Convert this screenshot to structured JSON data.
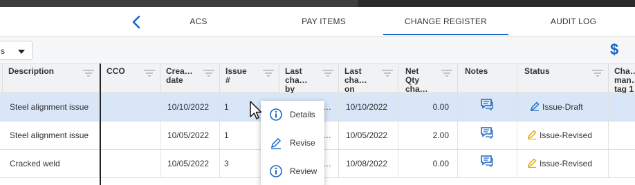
{
  "tabs": {
    "back_icon": "chevron-left-icon",
    "items": [
      {
        "label": "ACS"
      },
      {
        "label": "PAY ITEMS"
      },
      {
        "label": "CHANGE REGISTER"
      },
      {
        "label": "AUDIT LOG"
      }
    ],
    "active": "CHANGE REGISTER",
    "accent": "#1a66c2"
  },
  "toolbar": {
    "select_value": "s",
    "currency_symbol": "$"
  },
  "grid": {
    "columns": [
      {
        "label": "Description"
      },
      {
        "label": "CCO"
      },
      {
        "label": "Crea…\ndate"
      },
      {
        "label": "Issue\n#"
      },
      {
        "label": "Last\ncha…\nby"
      },
      {
        "label": "Last\ncha…\non"
      },
      {
        "label": "Net\nQty\ncha…"
      },
      {
        "label": "Notes"
      },
      {
        "label": "Status"
      },
      {
        "label": "Cha…\nman…\ntag 1"
      }
    ],
    "rows": [
      {
        "description": "Steel alignment issue",
        "cco": "",
        "created": "10/10/2022",
        "issue": "1",
        "changed_by": "…",
        "changed_on": "10/10/2022",
        "net_qty": "0.00",
        "status": "Issue-Draft"
      },
      {
        "description": "Steel alignment issue",
        "cco": "",
        "created": "10/05/2022",
        "issue": "1",
        "changed_by": "…",
        "changed_on": "10/05/2022",
        "net_qty": "2.00",
        "status": "Issue-Revised"
      },
      {
        "description": "Cracked weld",
        "cco": "",
        "created": "10/05/2022",
        "issue": "3",
        "changed_by": "…",
        "changed_on": "10/08/2022",
        "net_qty": "0.00",
        "status": "Issue-Revised"
      }
    ],
    "status_colors": {
      "Issue-Draft": "#1a66c2",
      "Issue-Revised": "#e6a100"
    },
    "selected_row_color": "#d8e6f7"
  },
  "context_menu": {
    "items": [
      {
        "label": "Details",
        "icon": "info-icon"
      },
      {
        "label": "Revise",
        "icon": "pencil-icon"
      },
      {
        "label": "Review",
        "icon": "info-icon"
      }
    ]
  }
}
